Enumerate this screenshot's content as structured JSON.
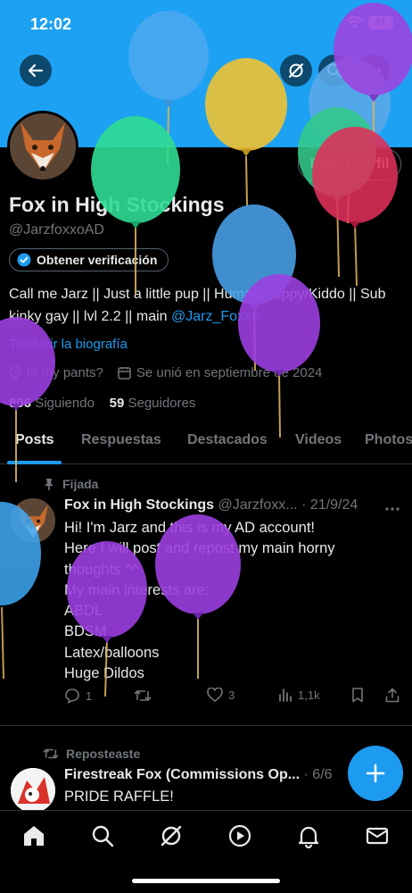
{
  "status_bar": {
    "time": "12:02",
    "battery": "91"
  },
  "header": {
    "edit_profile_label": "Editar perfil"
  },
  "profile": {
    "name": "Fox in High Stockings",
    "handle": "@JarzfoxxoAD",
    "verification_label": "Obtener verificación",
    "bio_text": "Call me Jarz || Just a little pup || Human/Puppy/Kiddo || Sub kinky gay || lvl 2.2 || main ",
    "bio_mention": "@Jarz_Foxxo",
    "translate_label": "Traducir la biografía",
    "location": "In my pants?",
    "joined": "Se unió en septiembre de 2024",
    "following_count": "806",
    "following_label": "Siguiendo",
    "followers_count": "59",
    "followers_label": "Seguidores"
  },
  "tabs": [
    "Posts",
    "Respuestas",
    "Destacados",
    "Videos",
    "Photos"
  ],
  "pinned_post": {
    "pin_label": "Fijada",
    "author": "Fox in High Stockings",
    "handle": "@Jarzfoxx...",
    "date": "· 21/9/24",
    "lines": [
      "Hi! I'm Jarz and this is my AD account!",
      "Here I will post and repost my main horny",
      "thoughts ^^",
      "My main interests are:",
      "ABDL",
      "BDSM",
      "Latex/balloons",
      "Huge Dildos"
    ],
    "replies": "1",
    "likes": "3",
    "views": "1,1k"
  },
  "repost": {
    "label": "Reposteaste",
    "author": "Firestreak Fox (Commissions Op...",
    "date": "· 6/6",
    "text": "PRIDE RAFFLE!"
  },
  "colors": {
    "accent": "#1d9bf0",
    "banner": "#1da1f2",
    "background": "#000000"
  },
  "nav_icons": [
    "home-icon",
    "search-icon",
    "grok-icon",
    "video-icon",
    "bell-icon",
    "mail-icon"
  ]
}
